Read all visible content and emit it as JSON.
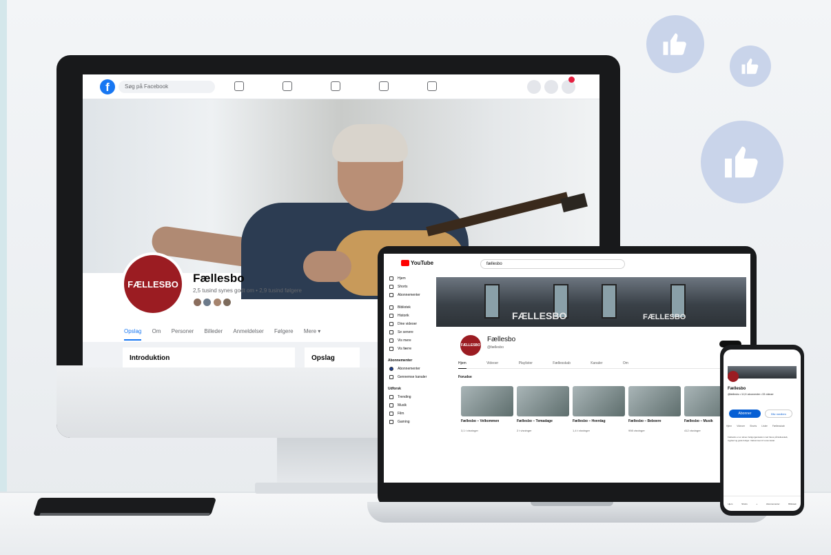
{
  "facebook": {
    "search_placeholder": "Søg på Facebook",
    "page_name": "Fællesbo",
    "stats": "2,5 tusind synes godt om • 2,9 tusind følgere",
    "profile_logo_text": "FÆLLESBO",
    "tabs": [
      "Opslag",
      "Om",
      "Personer",
      "Billeder",
      "Anmeldelser",
      "Følgere",
      "Mere ▾"
    ],
    "intro_title": "Introduktion",
    "posts_title": "Opslag",
    "brand_color": "#1877f2",
    "logo_color": "#9b1c22"
  },
  "youtube": {
    "logo_text": "YouTube",
    "search_text": "fællesbo",
    "channel_name": "Fællesbo",
    "channel_meta": "@fællesbo",
    "banner_sign_left": "FÆLLESBO",
    "banner_sign_right": "FÆLLESBO",
    "tabs": [
      "Hjem",
      "Videoer",
      "Playlister",
      "Fællesskab",
      "Kanaler",
      "Om"
    ],
    "section_title": "Forudse",
    "sidebar": {
      "main": [
        "Hjem",
        "Shorts",
        "Abonnementer"
      ],
      "you": [
        "Bibliotek",
        "Historik",
        "Dine videoer",
        "Se senere",
        "Vis mere",
        "Vis færre"
      ],
      "subs_title": "Abonnementer",
      "subs": [
        "Abonnementer",
        "Gennemse kanaler"
      ],
      "explore_title": "Udforsk",
      "explore": [
        "Trending",
        "Musik",
        "Film",
        "Gaming"
      ]
    },
    "videos": [
      {
        "title": "Fællesbo – Velkommen",
        "meta": "3,1 t visninger"
      },
      {
        "title": "Fællesbo – Temadage",
        "meta": "2 t visninger"
      },
      {
        "title": "Fællesbo – Hverdag",
        "meta": "1,4 t visninger"
      },
      {
        "title": "Fællesbo – Beboere",
        "meta": "998 visninger"
      },
      {
        "title": "Fællesbo – Musik",
        "meta": "412 visninger"
      }
    ]
  },
  "phone": {
    "channel_name": "Fællesbo",
    "channel_sub": "@fællesbo • 11,5 t abonnenter • 33 videoer",
    "subscribe_label": "Abonner",
    "join_label": "Bliv medlem",
    "tabs": [
      "Hjem",
      "Videoer",
      "Shorts",
      "Lister",
      "Fællesskab"
    ],
    "about": "Fællesbo er en almen boligorganisation med fokus på fællesskab, tryghed og gode boliger. Velkommen til vores kanal.",
    "nav": [
      "Hjem",
      "Shorts",
      "+",
      "Abonnementer",
      "Bibliotek"
    ]
  },
  "icons": [
    "thumbs-up-icon",
    "thumbs-up-icon",
    "thumbs-up-icon"
  ]
}
